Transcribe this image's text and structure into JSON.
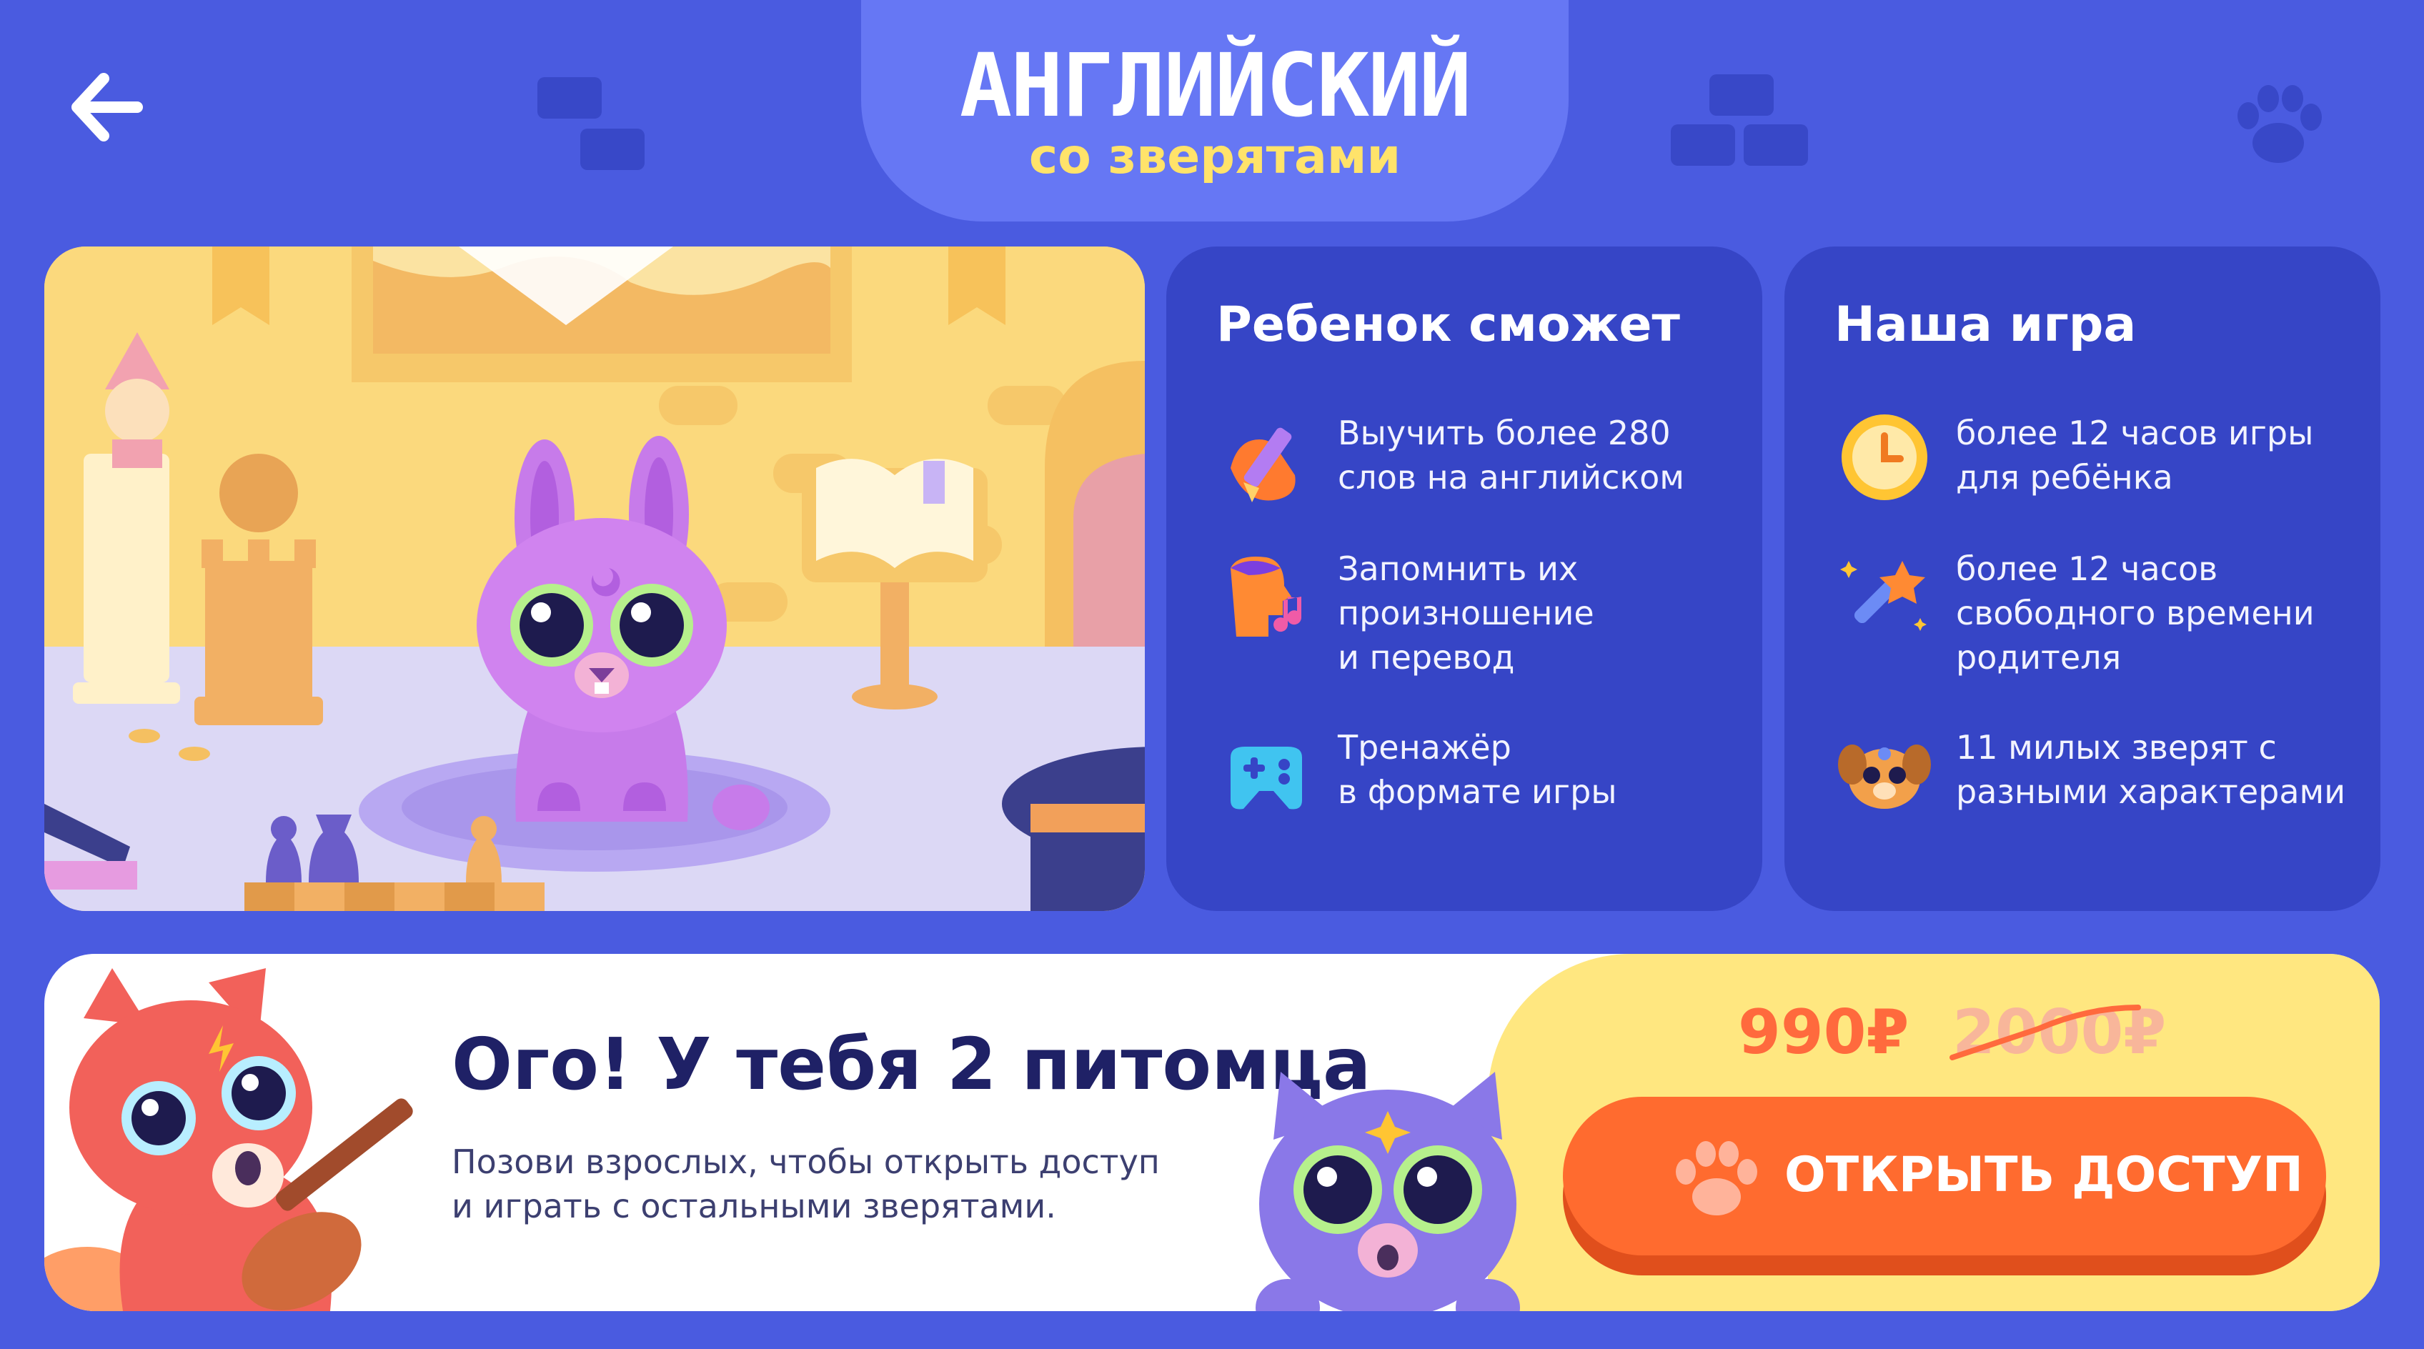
{
  "header": {
    "title_main": "АНГЛИЙСКИЙ",
    "title_sub": "со зверятами",
    "back_icon": "arrow-left-icon"
  },
  "colors": {
    "background": "#4A5BE0",
    "card": "#3645C6",
    "title_tab": "#6677F4",
    "accent_yellow": "#FFE36A",
    "accent_orange": "#FF6B2F"
  },
  "child_card": {
    "title": "Ребенок сможет",
    "items": [
      {
        "icon": "hand-pencil-icon",
        "text": "Выучить более 280\nслов на английском"
      },
      {
        "icon": "speaking-head-music-icon",
        "text": "Запомнить их\nпроизношение\nи перевод"
      },
      {
        "icon": "gamepad-icon",
        "text": "Тренажёр\nв формате игры"
      }
    ]
  },
  "game_card": {
    "title": "Наша игра",
    "items": [
      {
        "icon": "clock-icon",
        "text": "более 12 часов игры\nдля ребёнка"
      },
      {
        "icon": "magic-wand-icon",
        "text": "более 12 часов\nсвободного времени\nродителя"
      },
      {
        "icon": "puppy-face-icon",
        "text": "11 милых зверят с\nразными характерами"
      }
    ]
  },
  "banner": {
    "title": "Ого! У тебя 2 питомца",
    "text": "Позови взрослых, чтобы открыть доступ\nи играть с остальными зверятами.",
    "price": "990₽",
    "old_price": "2000₽",
    "button_label": "ОТКРЫТЬ ДОСТУП",
    "button_icon": "paw-icon"
  }
}
